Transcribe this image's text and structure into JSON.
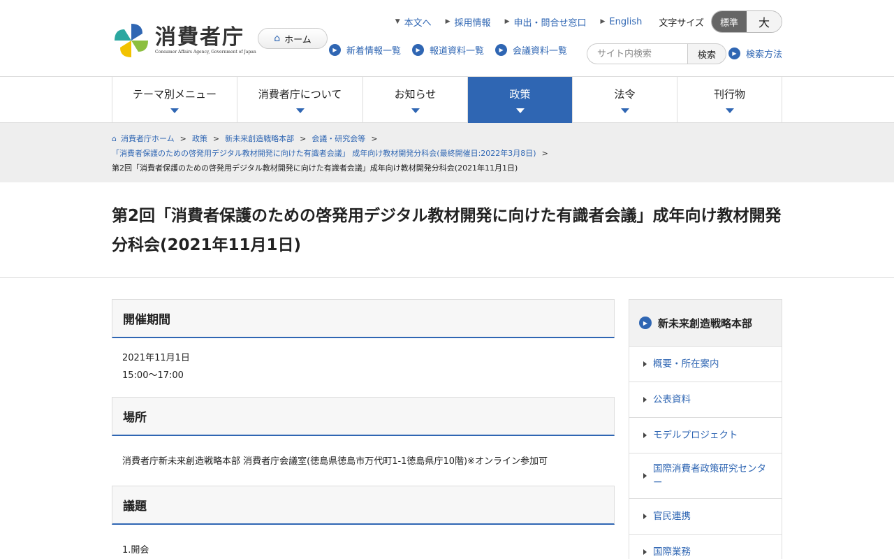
{
  "logo": {
    "title": "消費者庁",
    "subtitle": "Consumer Affairs Agency, Government of Japan"
  },
  "header": {
    "home_label": "ホーム",
    "util_links": [
      "本文へ",
      "採用情報",
      "申出・問合せ窓口",
      "English"
    ],
    "font_size_label": "文字サイズ",
    "font_size_options": [
      "標準",
      "大"
    ],
    "quick_links": [
      "新着情報一覧",
      "報道資料一覧",
      "会議資料一覧"
    ],
    "search_placeholder": "サイト内検索",
    "search_button": "検索",
    "search_help": "検索方法"
  },
  "gnav": {
    "items": [
      "テーマ別メニュー",
      "消費者庁について",
      "お知らせ",
      "政策",
      "法令",
      "刊行物"
    ],
    "active_index": 3
  },
  "breadcrumb": {
    "links": [
      "消費者庁ホーム",
      "政策",
      "新未来創造戦略本部",
      "会議・研究会等"
    ],
    "line2": "「消費者保護のための啓発用デジタル教材開発に向けた有識者会議」 成年向け教材開発分科会(最終開催日:2022年3月8日)",
    "current": "第2回「消費者保護のための啓発用デジタル教材開発に向けた有識者会議」成年向け教材開発分科会(2021年11月1日)"
  },
  "page": {
    "title": "第2回「消費者保護のための啓発用デジタル教材開発に向けた有識者会議」成年向け教材開発分科会(2021年11月1日)"
  },
  "sections": {
    "period": {
      "heading": "開催期間",
      "date": "2021年11月1日",
      "time": "15:00～17:00"
    },
    "place": {
      "heading": "場所",
      "text": "消費者庁新未来創造戦略本部 消費者庁会議室(徳島県徳島市万代町1-1徳島県庁10階)※オンライン参加可"
    },
    "agenda": {
      "heading": "議題",
      "first_item": "1.開会"
    }
  },
  "sidebar": {
    "heading": "新未来創造戦略本部",
    "items": [
      "概要・所在案内",
      "公表資料",
      "モデルプロジェクト",
      "国際消費者政策研究センター",
      "官民連携",
      "国際業務"
    ]
  },
  "colors": {
    "accent": "#2f66b3",
    "nav_active": "#2f66b3"
  }
}
